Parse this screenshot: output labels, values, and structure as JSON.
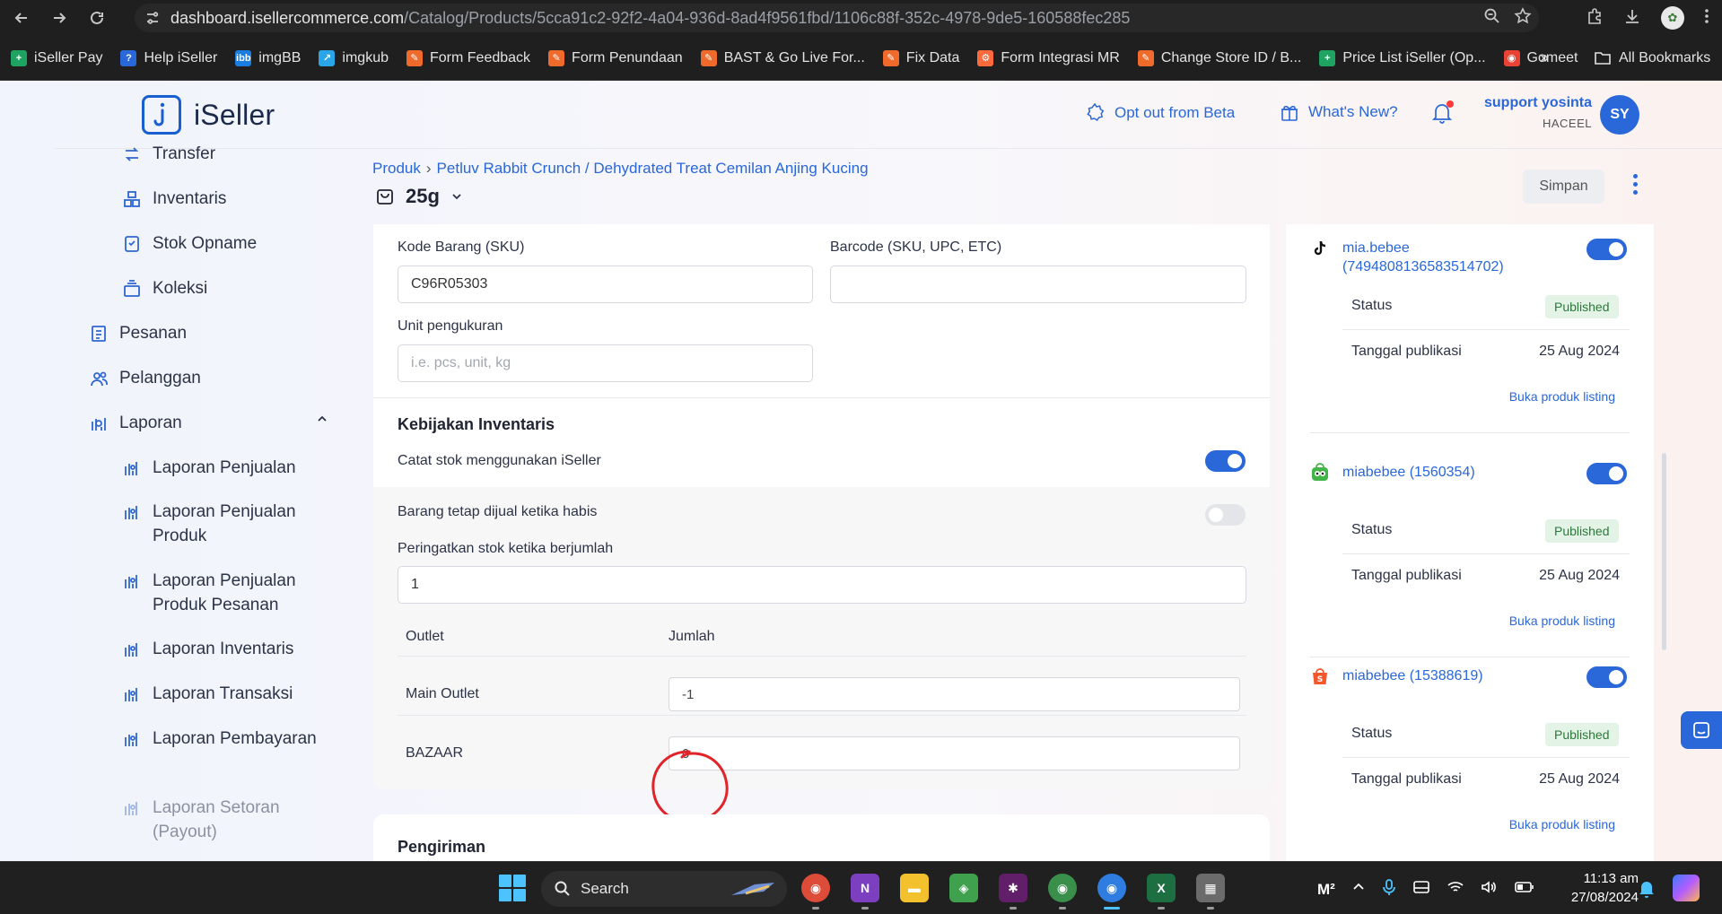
{
  "browser": {
    "url_host": "dashboard.isellercommerce.com",
    "url_path": "/Catalog/Products/5cca91c2-92f2-4a04-936d-8ad4f9561fbd/1106c88f-352c-4978-9de5-160588fec285",
    "bookmarks": [
      {
        "label": "iSeller Pay",
        "color": "#1ea362",
        "icon": "plus-icon"
      },
      {
        "label": "Help iSeller",
        "color": "#2a67d8",
        "icon": "help-icon"
      },
      {
        "label": "imgBB",
        "color": "#1a7de0",
        "icon": "imgbb-icon"
      },
      {
        "label": "imgkub",
        "color": "#2aa6e8",
        "icon": "imgkub-icon"
      },
      {
        "label": "Form Feedback",
        "color": "#f06a2b",
        "icon": "form-icon"
      },
      {
        "label": "Form Penundaan",
        "color": "#f06a2b",
        "icon": "form-icon"
      },
      {
        "label": "BAST & Go Live For...",
        "color": "#f06a2b",
        "icon": "form-icon"
      },
      {
        "label": "Fix Data",
        "color": "#f06a2b",
        "icon": "form-icon"
      },
      {
        "label": "Form Integrasi MR",
        "color": "#ff6a3d",
        "icon": "hubspot-icon"
      },
      {
        "label": "Change Store ID / B...",
        "color": "#f06a2b",
        "icon": "form-icon"
      },
      {
        "label": "Price List iSeller (Op...",
        "color": "#1ea362",
        "icon": "sheets-icon"
      },
      {
        "label": "Gomeet",
        "color": "#e84335",
        "icon": "gomeet-icon"
      }
    ],
    "bookmarks_more": "»",
    "all_bookmarks": "All Bookmarks"
  },
  "header": {
    "logo_text": "iSeller",
    "opt_out": "Opt out from Beta",
    "whats_new": "What's New?",
    "user_name": "support yosinta",
    "user_store": "HACEEL",
    "user_initials": "SY"
  },
  "sidebar": {
    "items": [
      {
        "label": "Transfer",
        "icon": "transfer-icon"
      },
      {
        "label": "Inventaris",
        "icon": "boxes-icon"
      },
      {
        "label": "Stok Opname",
        "icon": "stock-opname-icon"
      },
      {
        "label": "Koleksi",
        "icon": "collection-icon"
      },
      {
        "label": "Pesanan",
        "icon": "orders-icon"
      },
      {
        "label": "Pelanggan",
        "icon": "customers-icon"
      },
      {
        "label": "Laporan",
        "icon": "reports-icon"
      },
      {
        "label": "Laporan Penjualan",
        "icon": "report-icon"
      },
      {
        "label": "Laporan Penjualan",
        "label2": "Produk",
        "icon": "report-icon"
      },
      {
        "label": "Laporan Penjualan",
        "label2": "Produk Pesanan",
        "icon": "report-icon"
      },
      {
        "label": "Laporan Inventaris",
        "icon": "report-icon"
      },
      {
        "label": "Laporan Transaksi",
        "icon": "report-icon"
      },
      {
        "label": "Laporan Pembayaran",
        "icon": "report-icon"
      },
      {
        "label": "Laporan Setoran",
        "label2": "(Payout)",
        "icon": "report-icon"
      }
    ]
  },
  "page": {
    "breadcrumb_root": "Produk",
    "breadcrumb_sep": "›",
    "breadcrumb_product": "Petluv Rabbit Crunch / Dehydrated Treat Cemilan Anjing Kucing",
    "variant": "25g",
    "save_label": "Simpan"
  },
  "form": {
    "sku_label": "Kode Barang (SKU)",
    "sku_value": "C96R05303",
    "barcode_label": "Barcode (SKU, UPC, ETC)",
    "barcode_value": "",
    "unit_label": "Unit pengukuran",
    "unit_placeholder": "i.e. pcs, unit, kg",
    "inventory_policy_title": "Kebijakan Inventaris",
    "track_stock_label": "Catat stok menggunakan iSeller",
    "track_stock_on": true,
    "sell_when_out_label": "Barang tetap dijual ketika habis",
    "sell_when_out_on": false,
    "low_stock_label": "Peringatkan stok ketika berjumlah",
    "low_stock_value": "1",
    "col_outlet": "Outlet",
    "col_qty": "Jumlah",
    "outlets": [
      {
        "name": "Main Outlet",
        "qty": "-1"
      },
      {
        "name": "BAZAAR",
        "qty": "0"
      }
    ],
    "shipping_title": "Pengiriman"
  },
  "channels": [
    {
      "name": "mia.bebee",
      "name2": "(7494808136583514702)",
      "icon": "tiktok-icon",
      "enabled": true,
      "status_label": "Status",
      "status": "Published",
      "date_label": "Tanggal publikasi",
      "date": "25 Aug 2024",
      "link": "Buka produk listing"
    },
    {
      "name": "miabebee (1560354)",
      "icon": "tokopedia-icon",
      "enabled": true,
      "status_label": "Status",
      "status": "Published",
      "date_label": "Tanggal publikasi",
      "date": "25 Aug 2024",
      "link": "Buka produk listing"
    },
    {
      "name": "miabebee (15388619)",
      "icon": "shopee-icon",
      "enabled": true,
      "status_label": "Status",
      "status": "Published",
      "date_label": "Tanggal publikasi",
      "date": "25 Aug 2024",
      "link": "Buka produk listing"
    }
  ],
  "taskbar": {
    "search_label": "Search",
    "time": "11:13 am",
    "date": "27/08/2024",
    "apps": [
      {
        "name": "chrome-app-icon",
        "color": "#dd4b39"
      },
      {
        "name": "onenote-app-icon",
        "color": "#7b3fbf"
      },
      {
        "name": "file-explorer-app-icon",
        "color": "#f3c12e"
      },
      {
        "name": "layers-app-icon",
        "color": "#3fa14d"
      },
      {
        "name": "slack-app-icon",
        "color": "#611f69"
      },
      {
        "name": "chrome-profile-app-icon",
        "color": "#3a8f4b"
      },
      {
        "name": "chrome-active-app-icon",
        "color": "#2f7de1"
      },
      {
        "name": "excel-app-icon",
        "color": "#1d6f42"
      },
      {
        "name": "calculator-app-icon",
        "color": "#6b6b6b"
      }
    ]
  },
  "colors": {
    "accent": "#2a67d8",
    "annotation": "#e0242a",
    "published_bg": "#e3f3e6",
    "published_text": "#2b7a3a"
  }
}
